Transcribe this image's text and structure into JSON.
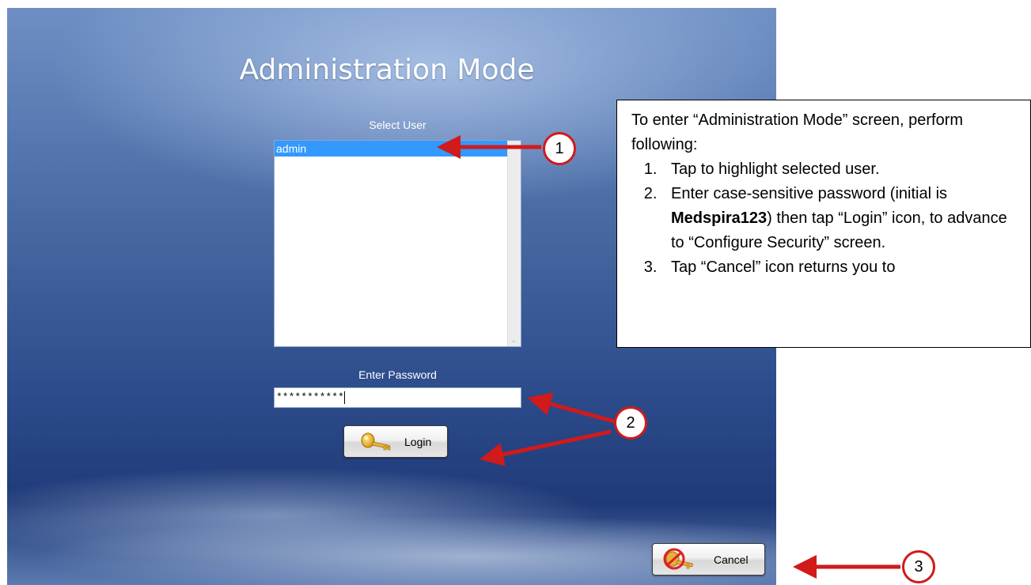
{
  "screen": {
    "title": "Administration Mode",
    "select_user_label": "Select User",
    "users": [
      "admin"
    ],
    "password_label": "Enter Password",
    "password_value": "***********",
    "login_label": "Login",
    "cancel_label": "Cancel"
  },
  "instructions": {
    "intro": "To enter “Administration Mode” screen, perform following:",
    "step1": "Tap to highlight selected user.",
    "step2_before": "Enter case-sensitive password (initial is ",
    "step2_bold": "Medspira123",
    "step2_after": ") then tap “Login” icon, to advance to “Configure Security” screen.",
    "step3": "Tap “Cancel” icon returns you to"
  },
  "callouts": {
    "one": "1",
    "two": "2",
    "three": "3"
  },
  "colors": {
    "arrow_red": "#d11a1a",
    "selection_blue": "#3399ff"
  },
  "icons": {
    "login": "key-icon",
    "cancel": "no-key-icon",
    "scroll": "chevron-down-icon"
  }
}
